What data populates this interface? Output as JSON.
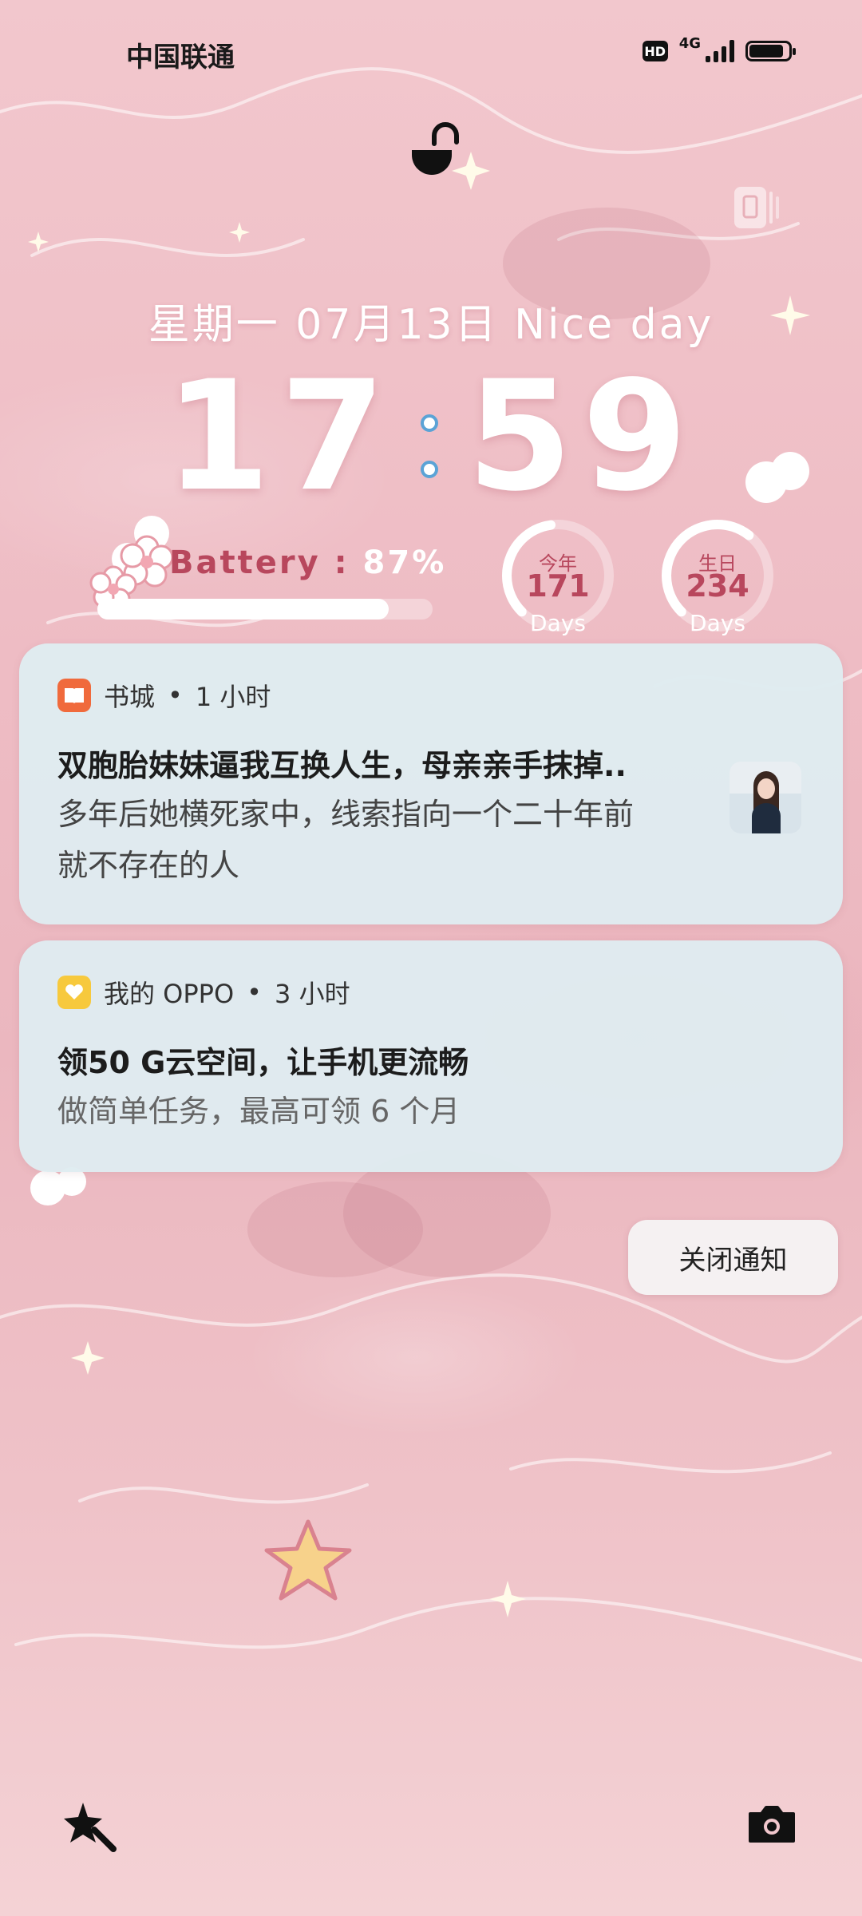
{
  "status_bar": {
    "carrier": "中国联通",
    "hd_badge": "HD",
    "network": "4G",
    "battery_level": 0.87
  },
  "lockscreen": {
    "date_line": "星期一  07月13日  Nice day",
    "time_hours": "17",
    "time_minutes": "59"
  },
  "battery_widget": {
    "label": "Battery",
    "separator": ":",
    "value": "87%",
    "level": 0.87
  },
  "countdowns": [
    {
      "label": "今年",
      "value": "171",
      "unit": "Days",
      "progress": 0.47
    },
    {
      "label": "生日",
      "value": "234",
      "unit": "Days",
      "progress": 0.64
    }
  ],
  "notifications": [
    {
      "app": "书城",
      "time": "1 小时",
      "title": "双胞胎妹妹逼我互换人生，母亲亲手抹掉..",
      "body_line1": "多年后她横死家中，线索指向一个二十年前",
      "body_line2": "就不存在的人",
      "icon_color": "#f06a3c"
    },
    {
      "app": "我的 OPPO",
      "time": "3 小时",
      "title": "领50 G云空间，让手机更流畅",
      "body_line1": "做简单任务，最高可领 6 个月",
      "icon_color": "#f7c93d"
    }
  ],
  "actions": {
    "close_notifications": "关闭通知"
  },
  "colors": {
    "accent_text": "#b8475d",
    "card_bg": "#dfecf0"
  }
}
